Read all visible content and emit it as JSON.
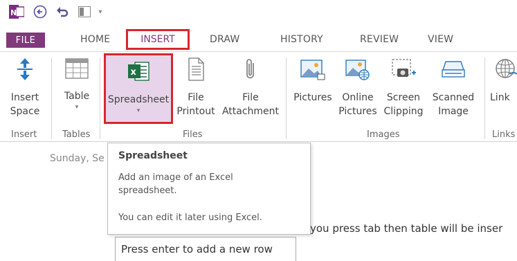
{
  "quick_access": {
    "icons": [
      "onenote-logo-icon",
      "back-icon",
      "undo-icon",
      "dock-icon",
      "customize-icon"
    ]
  },
  "tabs": {
    "file": "FILE",
    "home": "HOME",
    "insert": "INSERT",
    "draw": "DRAW",
    "history": "HISTORY",
    "review": "REVIEW",
    "view": "VIEW"
  },
  "ribbon": {
    "insert_space": {
      "line1": "Insert",
      "line2": "Space"
    },
    "table": {
      "label": "Table"
    },
    "spreadsheet": {
      "label": "Spreadsheet"
    },
    "file_printout": {
      "line1": "File",
      "line2": "Printout"
    },
    "file_attachment": {
      "line1": "File",
      "line2": "Attachment"
    },
    "pictures": {
      "label": "Pictures"
    },
    "online_pictures": {
      "line1": "Online",
      "line2": "Pictures"
    },
    "screen_clipping": {
      "line1": "Screen",
      "line2": "Clipping"
    },
    "scanned_image": {
      "line1": "Scanned",
      "line2": "Image"
    },
    "links": {
      "label": "Link"
    },
    "groups": {
      "insert": "Insert",
      "tables": "Tables",
      "files": "Files",
      "images": "Images",
      "links": "Links"
    }
  },
  "page": {
    "date": "Sunday, Se",
    "body_text": "you press tab then table will be inser",
    "table_cell": "Press enter to add a new row"
  },
  "tooltip": {
    "title": "Spreadsheet",
    "description": "Add an image of an Excel spreadsheet.",
    "note": "You can edit it later using Excel."
  },
  "colors": {
    "file_tab": "#80397b",
    "highlight_border": "#d8262e",
    "spreadsheet_bg": "#e8d4ea",
    "excel_green": "#1e7145"
  }
}
